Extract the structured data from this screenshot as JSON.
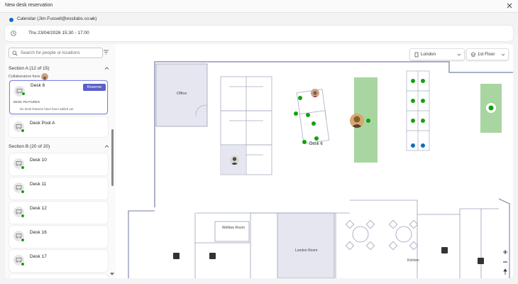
{
  "window": {
    "title": "New desk reservation"
  },
  "calendar": {
    "label": "Calendar (Jim.Fussell@essilabs.co.uk)"
  },
  "datetime": {
    "value": "Thu 23/04/2026 15:30 - 17:00"
  },
  "search": {
    "placeholder": "Search for people or locations"
  },
  "sections": [
    {
      "label": "Section A (12 of 15)"
    },
    {
      "label": "Section B (20 of 20)"
    }
  ],
  "collaborators_label": "Collaborators here",
  "selected_desk": {
    "name": "Desk 6",
    "reserve_label": "Reserve",
    "features_heading": "DESK FEATURES",
    "features_empty": "No desk features have been added yet"
  },
  "desk_pool": {
    "name": "Desk Pool A"
  },
  "desks_b": [
    {
      "name": "Desk 10"
    },
    {
      "name": "Desk 11"
    },
    {
      "name": "Desk 12"
    },
    {
      "name": "Desk 16"
    },
    {
      "name": "Desk 17"
    }
  ],
  "map": {
    "location": "London",
    "floor": "1st Floor",
    "rooms": {
      "office": "Office",
      "welfare": "Welfare Room",
      "london_room": "London Room",
      "kitchen": "Kitchen"
    },
    "desk_label": "Desk 6"
  },
  "colors": {
    "accent": "#5b5fc7",
    "available": "#13a10e",
    "desk_green": "#a8d5a0",
    "selected_blue": "#0f6cbd",
    "room_fill": "#e5e6f0"
  }
}
